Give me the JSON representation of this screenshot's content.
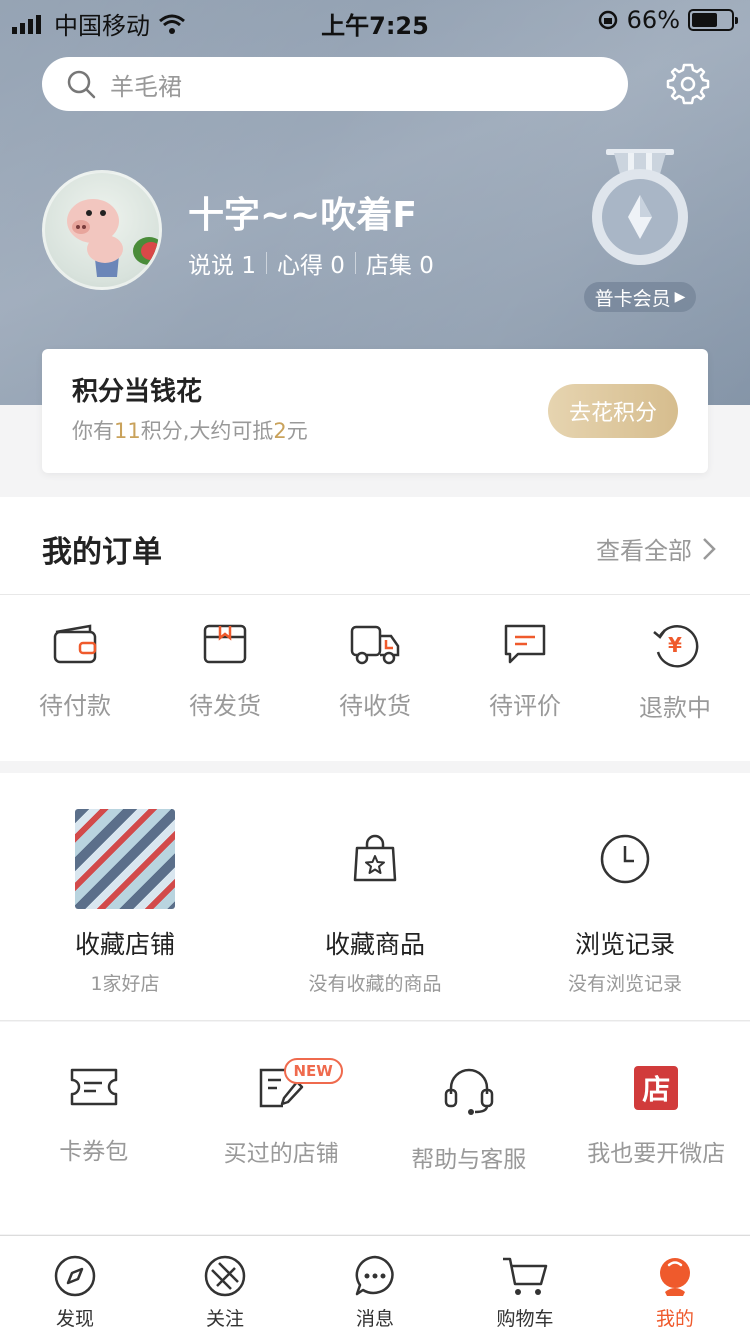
{
  "status_bar": {
    "carrier": "中国移动",
    "time": "上午7:25",
    "battery": "66%",
    "battery_level": 0.66
  },
  "search": {
    "placeholder": "羊毛裙"
  },
  "profile": {
    "name": "十字~~吹着F",
    "stats": [
      {
        "label": "说说",
        "count": "1"
      },
      {
        "label": "心得",
        "count": "0"
      },
      {
        "label": "店集",
        "count": "0"
      }
    ],
    "membership": "普卡会员"
  },
  "points": {
    "title": "积分当钱花",
    "desc_prefix": "你有",
    "points_value": "11",
    "desc_mid": "积分,大约可抵",
    "money_value": "2",
    "desc_suffix": "元",
    "button": "去花积分"
  },
  "orders": {
    "title": "我的订单",
    "view_all": "查看全部",
    "items": [
      {
        "label": "待付款",
        "icon": "wallet-icon"
      },
      {
        "label": "待发货",
        "icon": "box-icon"
      },
      {
        "label": "待收货",
        "icon": "truck-icon"
      },
      {
        "label": "待评价",
        "icon": "comment-icon"
      },
      {
        "label": "退款中",
        "icon": "refund-icon"
      }
    ]
  },
  "favorites": [
    {
      "name": "收藏店铺",
      "sub": "1家好店"
    },
    {
      "name": "收藏商品",
      "sub": "没有收藏的商品"
    },
    {
      "name": "浏览记录",
      "sub": "没有浏览记录"
    }
  ],
  "tools": [
    {
      "label": "卡券包",
      "icon": "coupon-icon"
    },
    {
      "label": "买过的店铺",
      "icon": "shop-note-icon",
      "badge": "NEW"
    },
    {
      "label": "帮助与客服",
      "icon": "headset-icon"
    },
    {
      "label": "我也要开微店",
      "icon": "store-icon",
      "icon_text": "店"
    }
  ],
  "tabbar": [
    {
      "label": "发现",
      "icon": "compass-icon"
    },
    {
      "label": "关注",
      "icon": "follow-icon"
    },
    {
      "label": "消息",
      "icon": "message-icon"
    },
    {
      "label": "购物车",
      "icon": "cart-icon"
    },
    {
      "label": "我的",
      "icon": "profile-icon",
      "active": true
    }
  ],
  "colors": {
    "accent": "#ef5a2c",
    "gold": "#c9a25b",
    "header": "#8d9cae"
  }
}
